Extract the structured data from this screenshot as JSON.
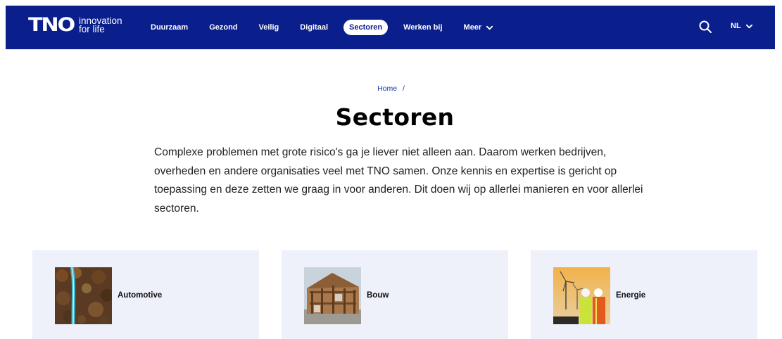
{
  "header": {
    "logo": {
      "mark": "TNO",
      "tagline_line1": "innovation",
      "tagline_line2": "for life"
    },
    "nav": [
      {
        "label": "Duurzaam",
        "active": false
      },
      {
        "label": "Gezond",
        "active": false
      },
      {
        "label": "Veilig",
        "active": false
      },
      {
        "label": "Digitaal",
        "active": false
      },
      {
        "label": "Sectoren",
        "active": true
      },
      {
        "label": "Werken bij",
        "active": false
      },
      {
        "label": "Meer",
        "active": false,
        "icon": "chevron-down-icon"
      }
    ],
    "search_icon": "search-icon",
    "language": {
      "label": "NL",
      "icon": "chevron-down-icon"
    }
  },
  "breadcrumb": {
    "home": "Home",
    "separator": "/"
  },
  "page": {
    "title": "Sectoren",
    "intro": "Complexe problemen met grote risico's ga je liever niet alleen aan. Daarom werken bedrijven, overheden en andere organisaties veel met TNO samen. Onze kennis en expertise is gericht op toepassing en deze zetten we graag in voor anderen. Dit doen wij op allerlei manieren en voor allerlei sectoren."
  },
  "sectors": [
    {
      "label": "Automotive",
      "image": "road-through-forest-aerial"
    },
    {
      "label": "Bouw",
      "image": "timber-frame-building"
    },
    {
      "label": "Energie",
      "image": "engineers-with-wind-turbines"
    }
  ],
  "colors": {
    "brand": "#0a1e8c",
    "card_bg": "#eef0fa",
    "link": "#1a34a8"
  }
}
